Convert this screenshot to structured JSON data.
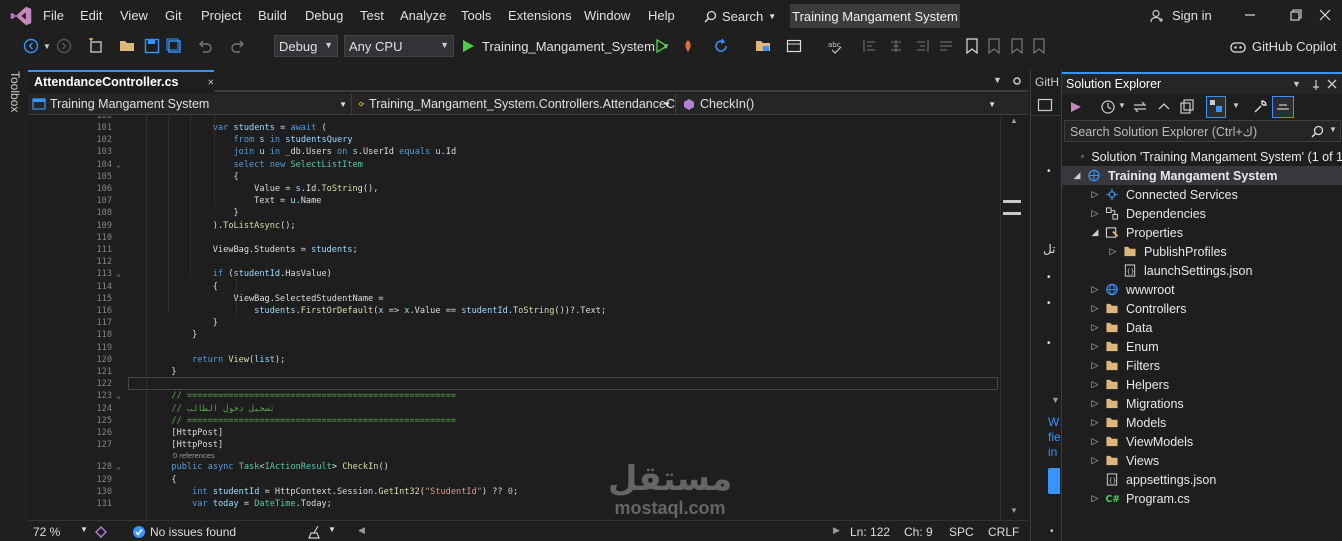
{
  "menu": {
    "items": [
      "File",
      "Edit",
      "View",
      "Git",
      "Project",
      "Build",
      "Debug",
      "Test",
      "Analyze",
      "Tools",
      "Extensions",
      "Window",
      "Help"
    ],
    "search_label": "Search",
    "window_title": "Training Mangament System",
    "sign_in": "Sign in"
  },
  "toolbar": {
    "config": "Debug",
    "platform": "Any CPU",
    "run_target": "Training_Mangament_System",
    "copilot": "GitHub Copilot"
  },
  "side": {
    "toolbox_label": "Toolbox"
  },
  "editor": {
    "tab_label": "AttendanceController.cs",
    "nav_project": "Training Mangament System",
    "nav_class": "Training_Mangament_System.Controllers.AttendanceC",
    "nav_member": "CheckIn()",
    "codelens_refs": "0 references",
    "lines": [
      {
        "n": "101",
        "t": "                var students = await ("
      },
      {
        "n": "102",
        "t": "                    from s in studentsQuery"
      },
      {
        "n": "103",
        "t": "                    join u in _db.Users on s.UserId equals u.Id"
      },
      {
        "n": "104",
        "t": "                    select new SelectListItem"
      },
      {
        "n": "105",
        "t": "                    {"
      },
      {
        "n": "106",
        "t": "                        Value = s.Id.ToString(),"
      },
      {
        "n": "107",
        "t": "                        Text = u.Name"
      },
      {
        "n": "108",
        "t": "                    }"
      },
      {
        "n": "109",
        "t": "                ).ToListAsync();"
      },
      {
        "n": "110",
        "t": ""
      },
      {
        "n": "111",
        "t": "                ViewBag.Students = students;"
      },
      {
        "n": "112",
        "t": ""
      },
      {
        "n": "113",
        "t": "                if (studentId.HasValue)"
      },
      {
        "n": "114",
        "t": "                {"
      },
      {
        "n": "115",
        "t": "                    ViewBag.SelectedStudentName ="
      },
      {
        "n": "116",
        "t": "                        students.FirstOrDefault(x => x.Value == studentId.ToString())?.Text;"
      },
      {
        "n": "117",
        "t": "                }"
      },
      {
        "n": "118",
        "t": "            }"
      },
      {
        "n": "119",
        "t": ""
      },
      {
        "n": "120",
        "t": "            return View(list);"
      },
      {
        "n": "121",
        "t": "        }"
      },
      {
        "n": "122",
        "t": ""
      },
      {
        "n": "123",
        "t": "        // ===================================================="
      },
      {
        "n": "124",
        "t": "        // تسجيل دخول الطالب"
      },
      {
        "n": "125",
        "t": "        // ===================================================="
      },
      {
        "n": "126",
        "t": "        [HttpPost]"
      },
      {
        "n": "127",
        "t": "        [HttpPost]"
      },
      {
        "n": "128",
        "t": "        public async Task<IActionResult> CheckIn()"
      },
      {
        "n": "129",
        "t": "        {"
      },
      {
        "n": "130",
        "t": "            int studentId = HttpContext.Session.GetInt32(\"StudentId\") ?? 0;"
      },
      {
        "n": "131",
        "t": "            var today = DateTime.Today;"
      }
    ]
  },
  "status": {
    "zoom": "72 %",
    "issues": "No issues found",
    "line": "Ln: 122",
    "col": "Ch: 9",
    "spc": "SPC",
    "eol": "CRLF"
  },
  "midpanel": {
    "tab_fragment": "GitH",
    "text_w": "W",
    "text_fie": "fie",
    "text_in": "in",
    "arabic_fragment": "تل"
  },
  "solution_explorer": {
    "title": "Solution Explorer",
    "search_placeholder": "Search Solution Explorer (Ctrl+ك)",
    "items": [
      {
        "label": "Solution 'Training Mangament System' (1 of 1",
        "icon": "solution-icon"
      },
      {
        "label": "Training Mangament System",
        "icon": "project-icon"
      },
      {
        "label": "Connected Services",
        "icon": "connected-services-icon"
      },
      {
        "label": "Dependencies",
        "icon": "dependencies-icon"
      },
      {
        "label": "Properties",
        "icon": "properties-icon"
      },
      {
        "label": "PublishProfiles",
        "icon": "folder-icon"
      },
      {
        "label": "launchSettings.json",
        "icon": "json-file-icon"
      },
      {
        "label": "wwwroot",
        "icon": "globe-icon"
      },
      {
        "label": "Controllers",
        "icon": "folder-icon"
      },
      {
        "label": "Data",
        "icon": "folder-icon"
      },
      {
        "label": "Enum",
        "icon": "folder-icon"
      },
      {
        "label": "Filters",
        "icon": "folder-icon"
      },
      {
        "label": "Helpers",
        "icon": "folder-icon"
      },
      {
        "label": "Migrations",
        "icon": "folder-icon"
      },
      {
        "label": "Models",
        "icon": "folder-icon"
      },
      {
        "label": "ViewModels",
        "icon": "folder-icon"
      },
      {
        "label": "Views",
        "icon": "folder-icon"
      },
      {
        "label": "appsettings.json",
        "icon": "json-file-icon"
      },
      {
        "label": "Program.cs",
        "icon": "csharp-file-icon"
      }
    ]
  },
  "watermark": {
    "arabic": "مستقل",
    "latin": "mostaql.com"
  }
}
